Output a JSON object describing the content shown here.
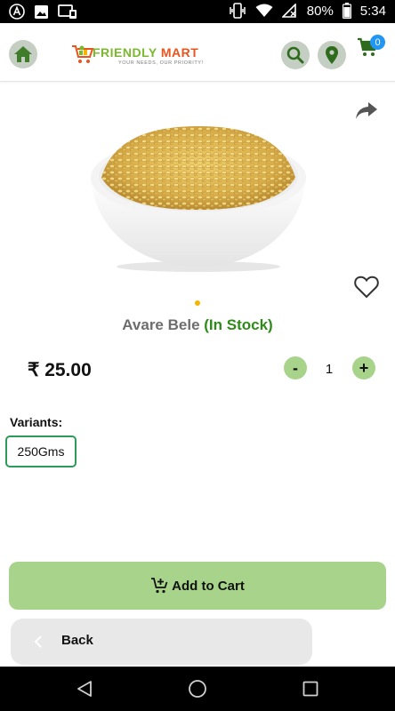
{
  "status_bar": {
    "battery_percent": "80%",
    "time": "5:34",
    "left_icons": [
      "app-a-icon",
      "image-icon",
      "cast-icon"
    ],
    "right_icons": [
      "vibrate-icon",
      "wifi-icon",
      "signal-off-icon",
      "battery-icon"
    ]
  },
  "header": {
    "logo_word1": "FRIENDLY",
    "logo_word2": "MART",
    "logo_tagline": "YOUR NEEDS, OUR PRIORITY!",
    "cart_count": "0",
    "icons": [
      "home-icon",
      "search-icon",
      "location-pin-icon",
      "cart-icon"
    ]
  },
  "product": {
    "name": "Avare Bele",
    "stock_status": "(In Stock)",
    "price": "₹ 25.00",
    "quantity": "1",
    "minus_label": "-",
    "plus_label": "+",
    "image_icon": "lentils-bowl-image",
    "carousel_active_index": 0,
    "carousel_count": 1
  },
  "variants": {
    "label": "Variants:",
    "options": [
      "250Gms"
    ],
    "selected": "250Gms"
  },
  "actions": {
    "add_to_cart_label": "Add to Cart",
    "back_label": "Back"
  },
  "colors": {
    "accent_green": "#a7d48a",
    "stock_green": "#2e8b19",
    "badge_blue": "#2196f3",
    "variant_border": "#2e9a5a",
    "carousel_dot": "#f5b400"
  }
}
